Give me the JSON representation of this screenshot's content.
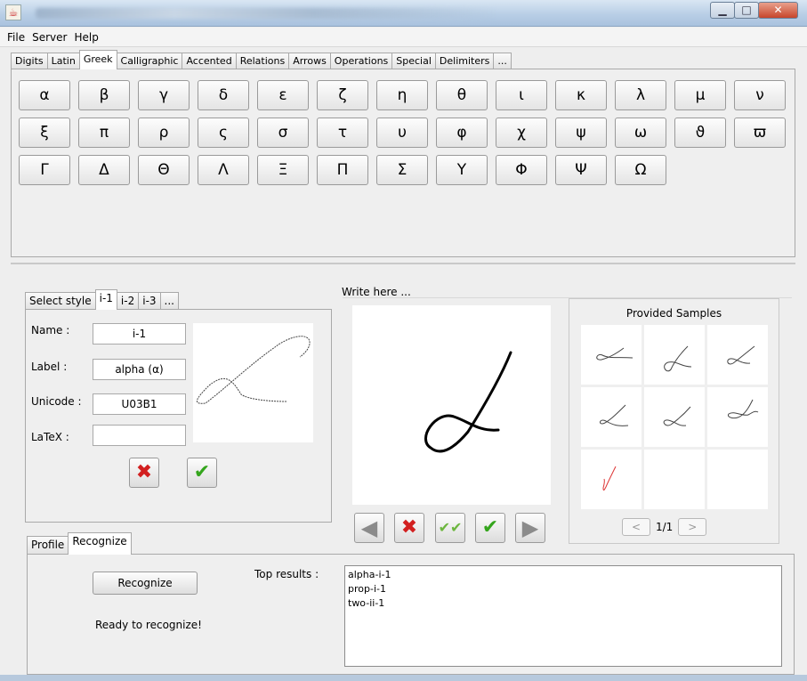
{
  "menubar": [
    "File",
    "Server",
    "Help"
  ],
  "symbol_tabs": [
    "Digits",
    "Latin",
    "Greek",
    "Calligraphic",
    "Accented",
    "Relations",
    "Arrows",
    "Operations",
    "Special",
    "Delimiters",
    "..."
  ],
  "active_symbol_tab": "Greek",
  "greek_rows": [
    [
      "α",
      "β",
      "γ",
      "δ",
      "ε",
      "ζ",
      "η",
      "θ",
      "ι",
      "κ",
      "λ",
      "μ",
      "ν"
    ],
    [
      "ξ",
      "π",
      "ρ",
      "ς",
      "σ",
      "τ",
      "υ",
      "φ",
      "χ",
      "ψ",
      "ω",
      "ϑ",
      "ϖ"
    ],
    [
      "Γ",
      "Δ",
      "Θ",
      "Λ",
      "Ξ",
      "Π",
      "Σ",
      "Υ",
      "Φ",
      "Ψ",
      "Ω"
    ]
  ],
  "style_tabs": [
    "Select style",
    "i-1",
    "i-2",
    "i-3",
    "..."
  ],
  "form": {
    "name_label": "Name :",
    "name_value": "i-1",
    "label_label": "Label :",
    "label_value": "alpha (α)",
    "unicode_label": "Unicode :",
    "unicode_value": "U03B1",
    "latex_label": "LaTeX :",
    "latex_value": ""
  },
  "write": {
    "label": "Write here ..."
  },
  "samples": {
    "title": "Provided Samples",
    "page": "1/1",
    "prev": "<",
    "next": ">"
  },
  "mode_tabs": [
    "Profile",
    "Recognize"
  ],
  "recognize": {
    "button": "Recognize",
    "status": "Ready to recognize!",
    "top_label": "Top results :",
    "results": [
      "alpha-i-1",
      "prop-i-1",
      "two-ii-1"
    ]
  },
  "icons": {
    "cancel": "red-x-icon",
    "confirm": "green-check-icon",
    "check_all": "double-check-icon",
    "back": "left-arrow-icon",
    "forward": "right-arrow-icon"
  }
}
